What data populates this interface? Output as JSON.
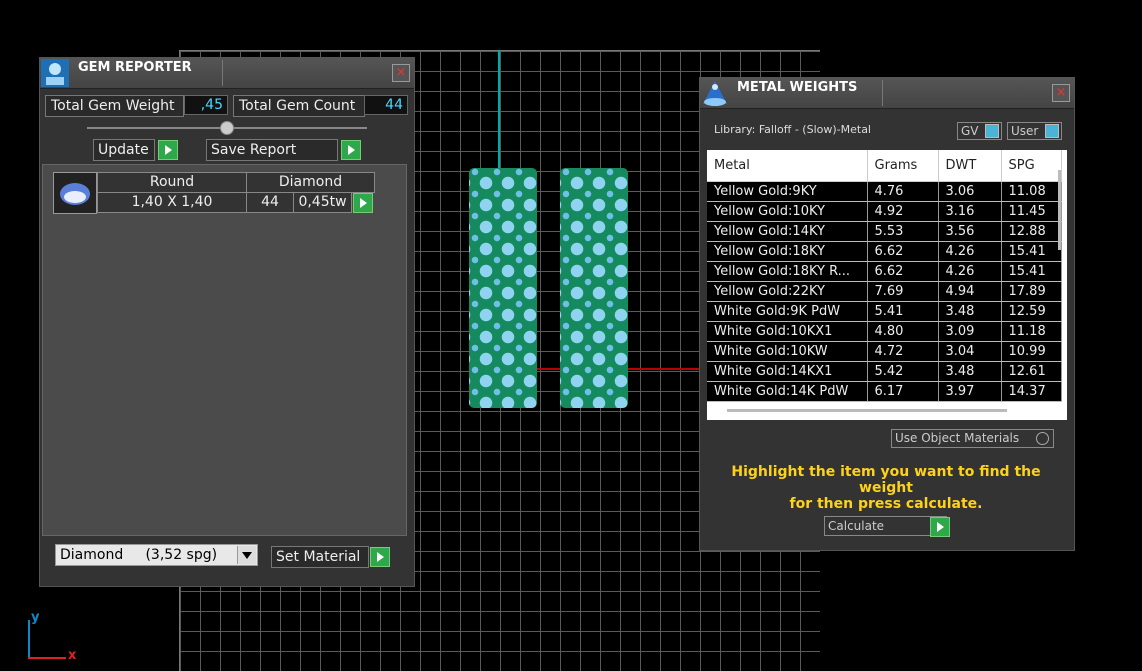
{
  "gem_reporter": {
    "title": "GEM REPORTER",
    "close_glyph": "×",
    "total_weight_label": "Total Gem Weight",
    "total_weight_value": ",45",
    "total_count_label": "Total Gem Count",
    "total_count_value": "44",
    "update_label": "Update",
    "save_report_label": "Save Report",
    "gem_row": {
      "shape": "Round",
      "material": "Diamond",
      "size": "1,40 X 1,40",
      "count": "44",
      "weight": "0,45tw"
    },
    "material_select": "Diamond     (3,52 spg)",
    "set_material_label": "Set Material"
  },
  "metal_weights": {
    "title": "METAL WEIGHTS",
    "close_glyph": "×",
    "library_label": "Library: Falloff - (Slow)-Metal",
    "gv_label": "GV",
    "user_label": "User",
    "columns": [
      "Metal",
      "Grams",
      "DWT",
      "SPG"
    ],
    "rows": [
      [
        "Yellow Gold:9KY",
        "4.76",
        "3.06",
        "11.08"
      ],
      [
        "Yellow Gold:10KY",
        "4.92",
        "3.16",
        "11.45"
      ],
      [
        "Yellow Gold:14KY",
        "5.53",
        "3.56",
        "12.88"
      ],
      [
        "Yellow Gold:18KY",
        "6.62",
        "4.26",
        "15.41"
      ],
      [
        "Yellow Gold:18KY R...",
        "6.62",
        "4.26",
        "15.41"
      ],
      [
        "Yellow Gold:22KY",
        "7.69",
        "4.94",
        "17.89"
      ],
      [
        "White Gold:9K PdW",
        "5.41",
        "3.48",
        "12.59"
      ],
      [
        "White Gold:10KX1",
        "4.80",
        "3.09",
        "11.18"
      ],
      [
        "White Gold:10KW",
        "4.72",
        "3.04",
        "10.99"
      ],
      [
        "White Gold:14KX1",
        "5.42",
        "3.48",
        "12.61"
      ],
      [
        "White Gold:14K PdW",
        "6.17",
        "3.97",
        "14.37"
      ]
    ],
    "use_object_materials_label": "Use Object Materials",
    "hint_line1": "Highlight the item you want to find the weight",
    "hint_line2": "for then press calculate.",
    "calculate_label": "Calculate"
  },
  "axes": {
    "y": "y",
    "x": "x"
  },
  "colors": {
    "value_text": "#48d8ff",
    "hint_text": "#ffd21a",
    "play_button": "#2ea84a",
    "gem_column": "#148a5e"
  }
}
